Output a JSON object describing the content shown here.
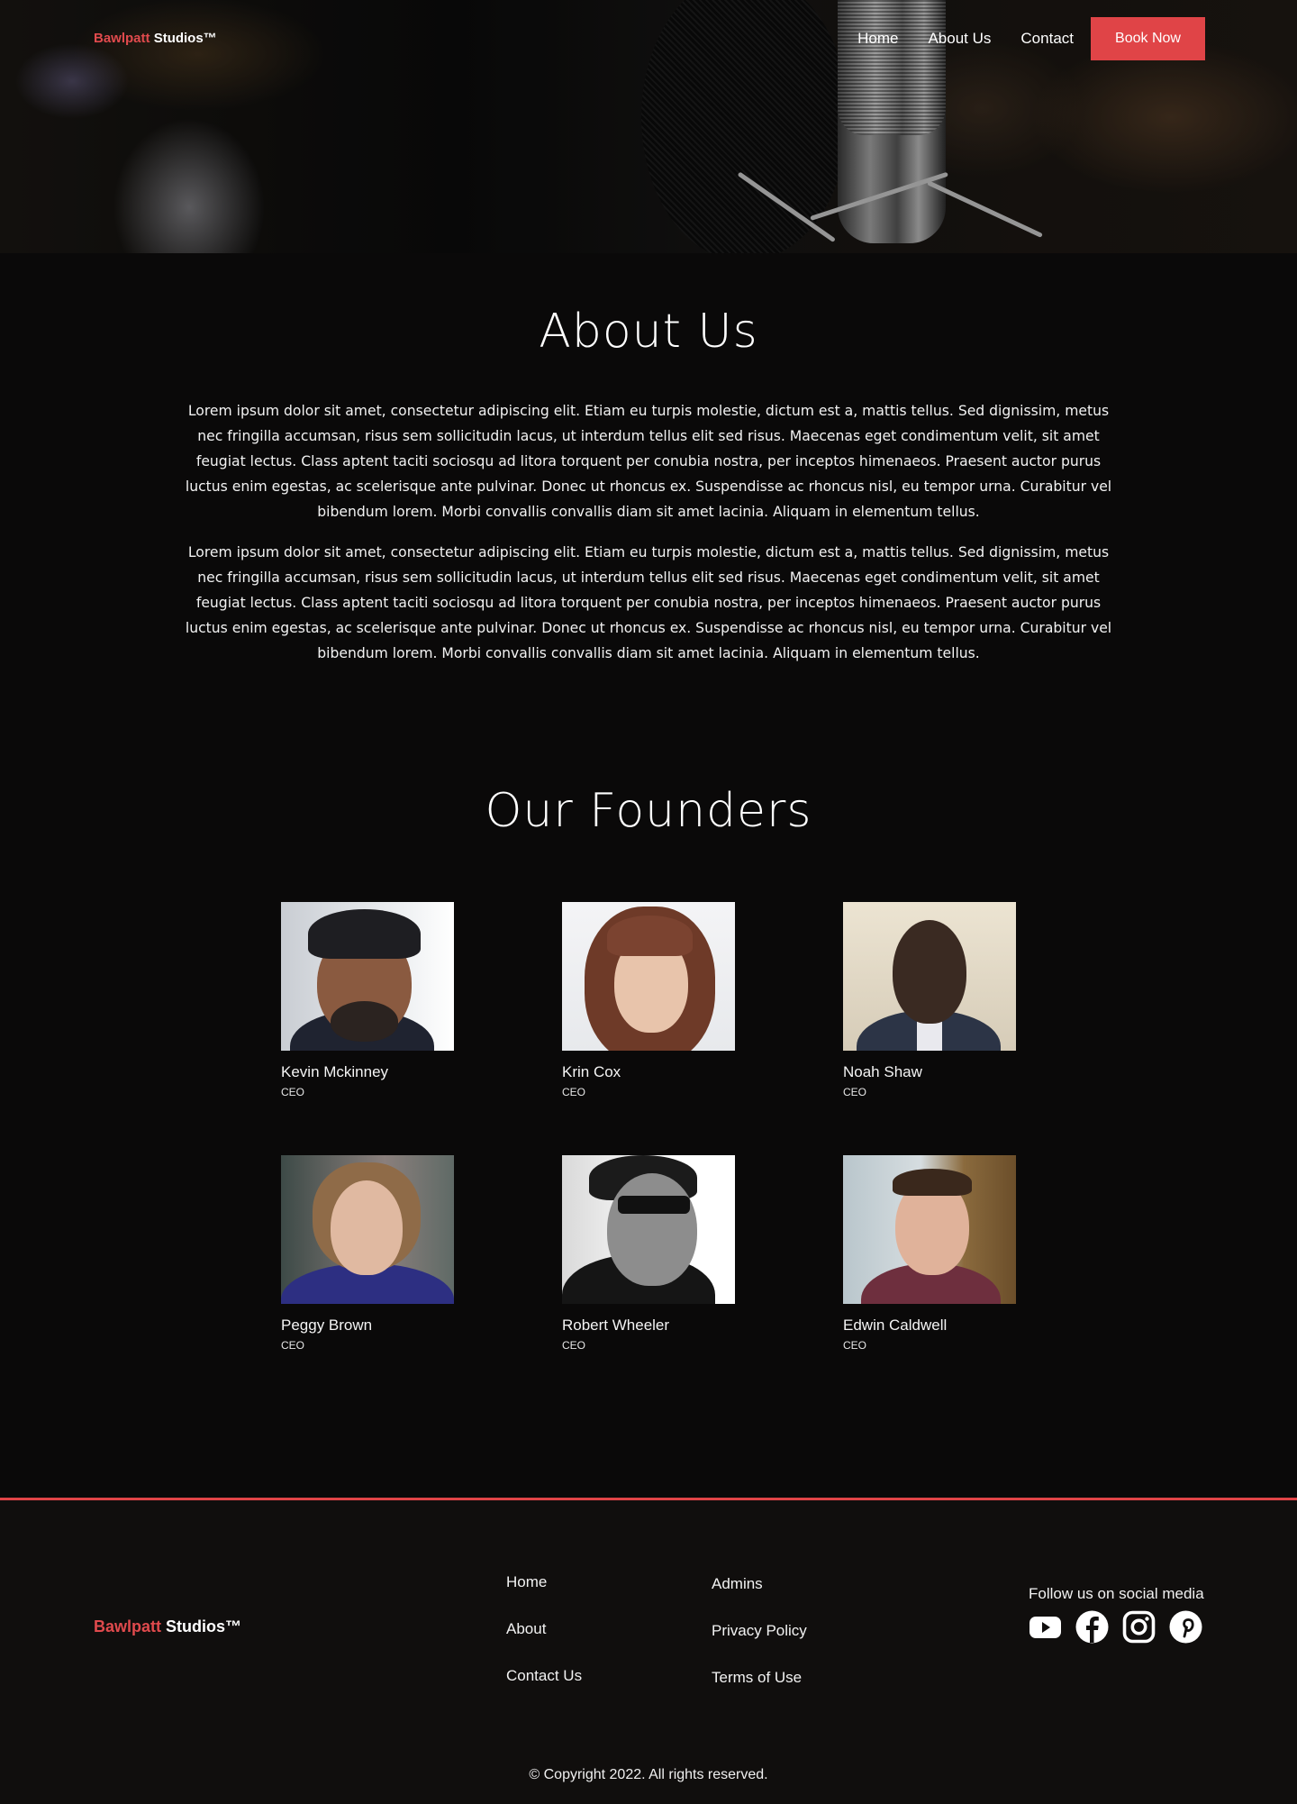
{
  "brand": {
    "part1": "Bawlpatt",
    "part2": "Studios™"
  },
  "nav": {
    "links": [
      "Home",
      "About Us",
      "Contact"
    ],
    "cta": "Book Now"
  },
  "about": {
    "title": "About Us",
    "paragraphs": [
      "Lorem ipsum dolor sit amet, consectetur adipiscing elit. Etiam eu turpis molestie, dictum est a, mattis tellus. Sed dignissim, metus nec fringilla accumsan, risus sem sollicitudin lacus, ut interdum tellus elit sed risus. Maecenas eget condimentum velit, sit amet feugiat lectus. Class aptent taciti sociosqu ad litora torquent per conubia nostra, per inceptos himenaeos. Praesent auctor purus luctus enim egestas, ac scelerisque ante pulvinar. Donec ut rhoncus ex. Suspendisse ac rhoncus nisl, eu tempor urna. Curabitur vel bibendum lorem. Morbi convallis convallis diam sit amet lacinia. Aliquam in elementum tellus.",
      "Lorem ipsum dolor sit amet, consectetur adipiscing elit. Etiam eu turpis molestie, dictum est a, mattis tellus. Sed dignissim, metus nec fringilla accumsan, risus sem sollicitudin lacus, ut interdum tellus elit sed risus. Maecenas eget condimentum velit, sit amet feugiat lectus. Class aptent taciti sociosqu ad litora torquent per conubia nostra, per inceptos himenaeos. Praesent auctor purus luctus enim egestas, ac scelerisque ante pulvinar. Donec ut rhoncus ex. Suspendisse ac rhoncus nisl, eu tempor urna. Curabitur vel bibendum lorem. Morbi convallis convallis diam sit amet lacinia. Aliquam in elementum tellus."
    ]
  },
  "founders": {
    "title": "Our Founders",
    "people": [
      {
        "name": "Kevin Mckinney",
        "role": "CEO"
      },
      {
        "name": "Krin Cox",
        "role": "CEO"
      },
      {
        "name": "Noah Shaw",
        "role": "CEO"
      },
      {
        "name": "Peggy Brown",
        "role": "CEO"
      },
      {
        "name": "Robert Wheeler",
        "role": "CEO"
      },
      {
        "name": "Edwin Caldwell",
        "role": "CEO"
      }
    ]
  },
  "footer": {
    "col1": [
      "Home",
      "About",
      "Contact Us"
    ],
    "col2": [
      "Admins",
      "Privacy Policy",
      "Terms of Use"
    ],
    "social_label": "Follow us on social media",
    "social_icons": [
      "youtube-icon",
      "facebook-icon",
      "instagram-icon",
      "pinterest-icon"
    ],
    "copyright": "© Copyright 2022. All rights reserved."
  },
  "colors": {
    "accent": "#e04447",
    "background": "#0a0909",
    "footer_bg": "#100e0d"
  }
}
